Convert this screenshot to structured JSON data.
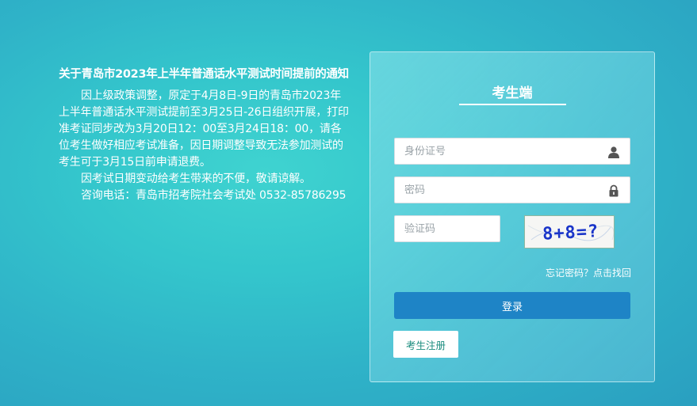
{
  "notice": {
    "title": "关于青岛市2023年上半年普通话水平测试时间提前的通知",
    "paragraphs": [
      "因上级政策调整，原定于4月8日-9日的青岛市2023年上半年普通话水平测试提前至3月25日-26日组织开展，打印准考证同步改为3月20日12：00至3月24日18：00，请各位考生做好相应考试准备，因日期调整导致无法参加测试的考生可于3月15日前申请退费。",
      "因考试日期变动给考生带来的不便，敬请谅解。",
      "咨询电话：青岛市招考院社会考试处  0532-85786295"
    ]
  },
  "login": {
    "title": "考生端",
    "id_placeholder": "身份证号",
    "id_value": "",
    "password_placeholder": "密码",
    "password_value": "",
    "captcha_placeholder": "验证码",
    "captcha_value": "",
    "captcha_image_text": "8+8=?",
    "forgot_label": "忘记密码？点击找回",
    "login_label": "登录",
    "register_label": "考生注册",
    "icons": {
      "id": "user-icon",
      "password": "lock-icon"
    }
  },
  "colors": {
    "login_button": "#1e84c6",
    "register_text": "#1a8c7e",
    "captcha_text": "#1a35c9"
  }
}
